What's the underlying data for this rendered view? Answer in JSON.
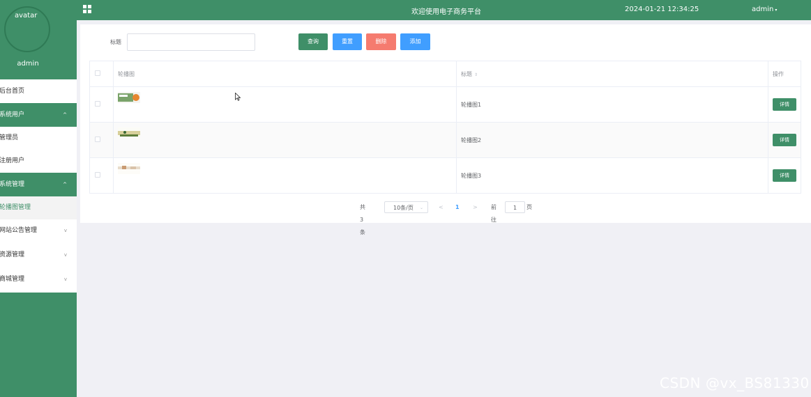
{
  "sidebar": {
    "avatar_alt": "avatar",
    "username": "admin",
    "menu": [
      {
        "label": "后台首页",
        "type": "item"
      },
      {
        "label": "系统用户",
        "type": "group",
        "arrow": "^"
      },
      {
        "label": "管理员",
        "type": "sub"
      },
      {
        "label": "注册用户",
        "type": "sub"
      },
      {
        "label": "系统管理",
        "type": "group",
        "arrow": "^"
      },
      {
        "label": "轮播图管理",
        "type": "sub-active"
      },
      {
        "label": "网站公告管理",
        "type": "coll",
        "arrow": "v"
      },
      {
        "label": "资源管理",
        "type": "coll",
        "arrow": "v"
      },
      {
        "label": "商城管理",
        "type": "coll",
        "arrow": "v"
      }
    ]
  },
  "topbar": {
    "title": "欢迎使用电子商务平台",
    "datetime": "2024-01-21 12:34:25",
    "account": "admin",
    "account_caret": "▾"
  },
  "filter": {
    "title_label": "标题",
    "title_value": "",
    "search_label": "查询",
    "reset_label": "重置",
    "delete_label": "删除",
    "add_label": "添加"
  },
  "table": {
    "columns": [
      "轮播图",
      "标题",
      "操作"
    ],
    "sort_icon": "⇕",
    "rows": [
      {
        "title": "轮播图1",
        "action": "详情"
      },
      {
        "title": "轮播图2",
        "action": "详情"
      },
      {
        "title": "轮播图3",
        "action": "详情"
      }
    ]
  },
  "pagination": {
    "total": "共 3 条",
    "page_size": "10条/页",
    "prev": "<",
    "current": "1",
    "next": ">",
    "goto_label": "前往",
    "goto_value": "1",
    "unit": "页"
  },
  "watermark": "CSDN @vx_BS81330",
  "colors": {
    "primary": "#3f8f68",
    "blue": "#409eff",
    "danger": "#f57b6f"
  }
}
